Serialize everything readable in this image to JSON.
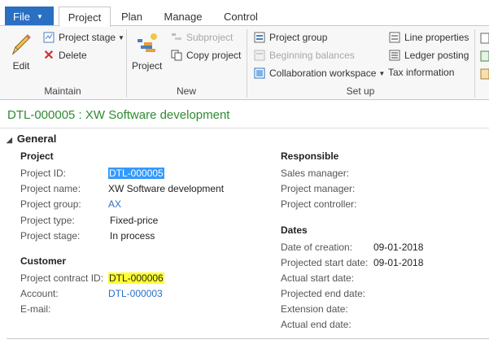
{
  "tabs": {
    "file": "File",
    "project": "Project",
    "plan": "Plan",
    "manage": "Manage",
    "control": "Control"
  },
  "ribbon": {
    "maintain": {
      "label": "Maintain",
      "edit": "Edit",
      "project_stage": "Project stage",
      "delete": "Delete"
    },
    "new": {
      "label": "New",
      "project": "Project",
      "subproject": "Subproject",
      "copy_project": "Copy project"
    },
    "setup": {
      "label": "Set up",
      "project_group": "Project group",
      "beginning_balances": "Beginning balances",
      "collaboration_workspace": "Collaboration workspace",
      "line_properties": "Line properties",
      "ledger_posting": "Ledger posting",
      "tax_information": "Tax information"
    }
  },
  "page_title": "DTL-000005 : XW Software development",
  "general": {
    "title": "General",
    "project": {
      "title": "Project",
      "id_label": "Project ID:",
      "id_value": "DTL-000005",
      "name_label": "Project name:",
      "name_value": "XW Software development",
      "group_label": "Project group:",
      "group_value": "AX",
      "type_label": "Project type:",
      "type_value": "Fixed-price",
      "stage_label": "Project stage:",
      "stage_value": "In process"
    },
    "customer": {
      "title": "Customer",
      "contract_label": "Project contract ID:",
      "contract_value": "DTL-000006",
      "account_label": "Account:",
      "account_value": "DTL-000003",
      "email_label": "E-mail:"
    },
    "responsible": {
      "title": "Responsible",
      "sales_label": "Sales manager:",
      "pm_label": "Project manager:",
      "controller_label": "Project controller:"
    },
    "dates": {
      "title": "Dates",
      "creation_label": "Date of creation:",
      "creation_value": "09-01-2018",
      "proj_start_label": "Projected start date:",
      "proj_start_value": "09-01-2018",
      "act_start_label": "Actual start date:",
      "proj_end_label": "Projected end date:",
      "ext_label": "Extension date:",
      "act_end_label": "Actual end date:"
    }
  },
  "colors": {
    "accent": "#2a6fc1",
    "title_green": "#2e8b32",
    "selection": "#3399ff",
    "highlight": "#ffff33"
  }
}
